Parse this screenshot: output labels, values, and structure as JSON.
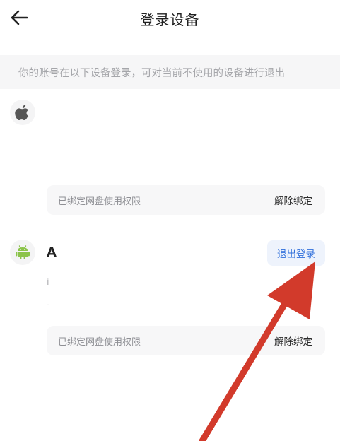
{
  "header": {
    "title": "登录设备",
    "back_icon": "arrow-left-icon"
  },
  "notice": {
    "text": "你的账号在以下设备登录，可对当前不使用的设备进行退出"
  },
  "devices": [
    {
      "icon": "apple-icon",
      "name": "",
      "bind_label": "已绑定网盘使用权限",
      "unbind_label": "解除绑定"
    },
    {
      "icon": "android-icon",
      "name": "A",
      "meta_line1": "i",
      "meta_line2": "-",
      "logout_label": "退出登录",
      "bind_label": "已绑定网盘使用权限",
      "unbind_label": "解除绑定"
    }
  ],
  "colors": {
    "accent": "#2f6fdb",
    "android_green": "#8bc34a",
    "annotation_red": "#d23a2b"
  }
}
